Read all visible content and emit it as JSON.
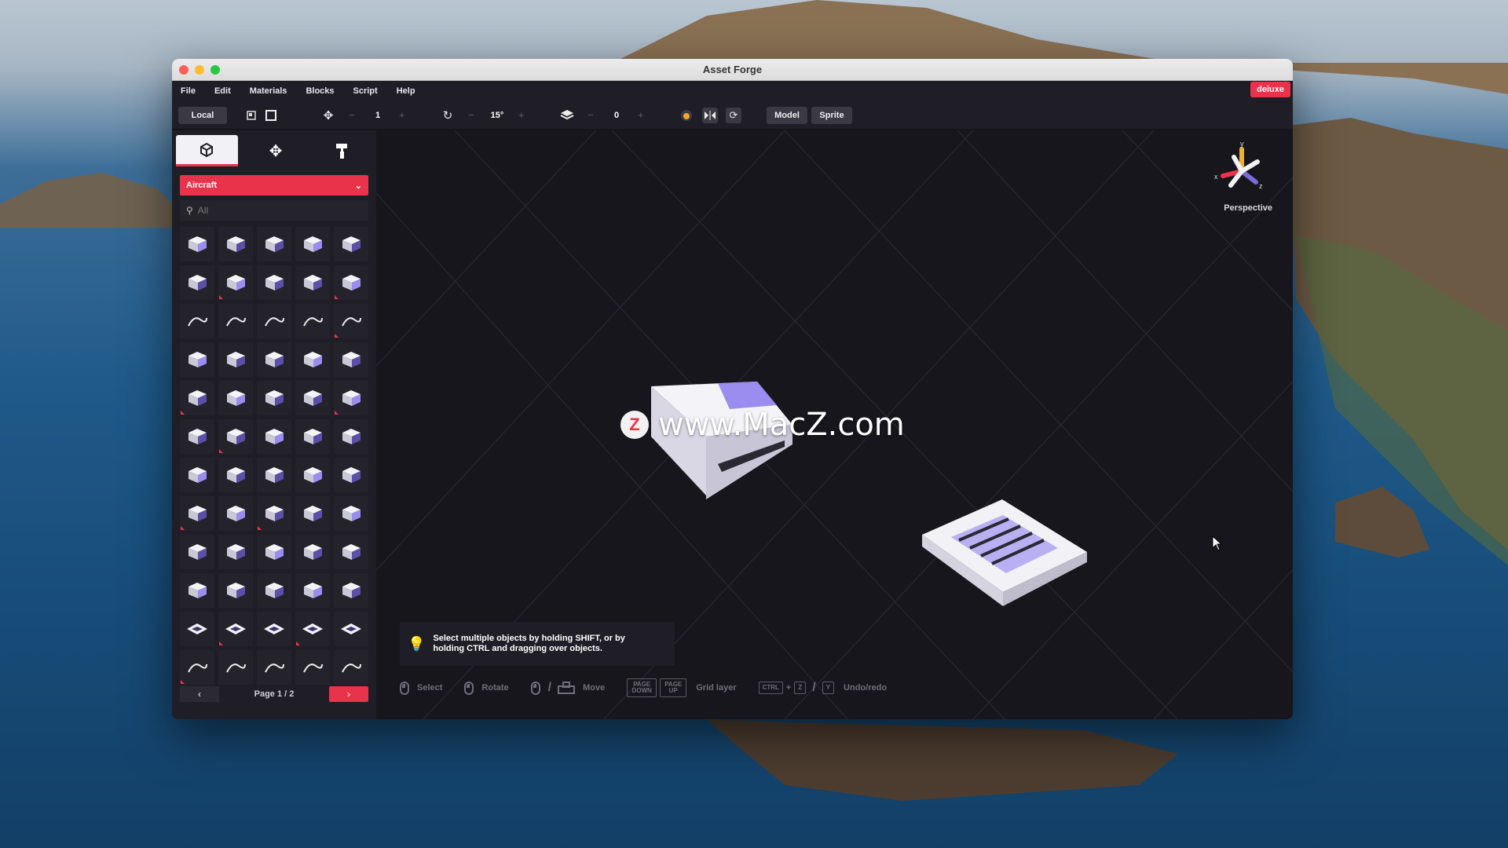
{
  "window": {
    "title": "Asset Forge"
  },
  "menu": [
    "File",
    "Edit",
    "Materials",
    "Blocks",
    "Script",
    "Help"
  ],
  "badge": "deluxe",
  "toolbar": {
    "space_label": "Local",
    "move_step": "1",
    "rotate_step": "15°",
    "layer": "0",
    "minus": "−",
    "plus": "+",
    "model_label": "Model",
    "sprite_label": "Sprite"
  },
  "sidebar": {
    "tabs": [
      "cube-icon",
      "move-icon",
      "paint-roller-icon"
    ],
    "category": "Aircraft",
    "search_placeholder": "All",
    "pager": {
      "prev": "‹",
      "label": "Page 1 / 2",
      "next": "›"
    }
  },
  "viewport": {
    "view_label": "Perspective",
    "axes": {
      "x": "x",
      "y": "y",
      "z": "z"
    },
    "hint": "Select multiple objects by holding SHIFT, or by holding CTRL and dragging over objects.",
    "shortcuts": {
      "select": "Select",
      "rotate": "Rotate",
      "move": "Move",
      "page_down": "PAGE DOWN",
      "page_up": "PAGE UP",
      "grid_layer": "Grid layer",
      "ctrl": "CTRL",
      "z": "Z",
      "y": "Y",
      "undo_redo": "Undo/redo"
    }
  },
  "watermark": {
    "logo": "Z",
    "text": "www.MacZ.com"
  },
  "colors": {
    "accent": "#e8334a",
    "panel": "#1f1e26",
    "viewport": "#17161d",
    "purple": "#9b8cf0"
  }
}
